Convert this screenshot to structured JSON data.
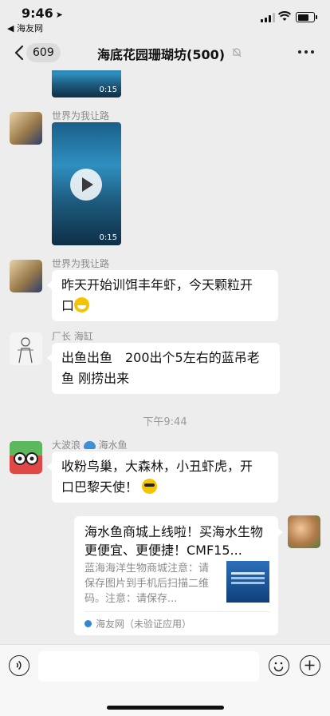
{
  "status_bar": {
    "time": "9:46",
    "back_app": "◀ 海友网"
  },
  "nav": {
    "unread_count": "609",
    "title": "海底花园珊瑚坊(500)"
  },
  "messages": [
    {
      "type": "video",
      "duration": "0:15"
    },
    {
      "type": "video",
      "sender": "世界为我让路",
      "duration": "0:15"
    },
    {
      "type": "text",
      "sender": "世界为我让路",
      "line1": "昨天开始训饵丰年虾，今天颗粒开",
      "line2": "口"
    },
    {
      "type": "text",
      "sender": "厂长 海缸",
      "line1": "出鱼出鱼　200出个5左右的蓝吊老",
      "line2": "鱼 刚捞出来"
    },
    {
      "type": "timestamp",
      "text": "下午9:44"
    },
    {
      "type": "text",
      "sender": "大波浪",
      "sender_suffix": "海水鱼",
      "line1": "收粉鸟巢，大森林，小丑虾虎，开",
      "line2": "口巴黎天使！"
    },
    {
      "type": "link_card",
      "title": "海水鱼商城上线啦！买海水生物更便宜、更便捷！CMF15...",
      "description": "蓝海海洋生物商城注意：请保存图片到手机后扫描二维码。注意：请保存...",
      "source": "海友网（未验证应用）"
    }
  ],
  "input": {
    "placeholder": ""
  },
  "colors": {
    "background": "#ededed",
    "bubble": "#ffffff",
    "text": "#111111",
    "meta": "#8a8a8a",
    "link_source": "#2f88d0"
  }
}
